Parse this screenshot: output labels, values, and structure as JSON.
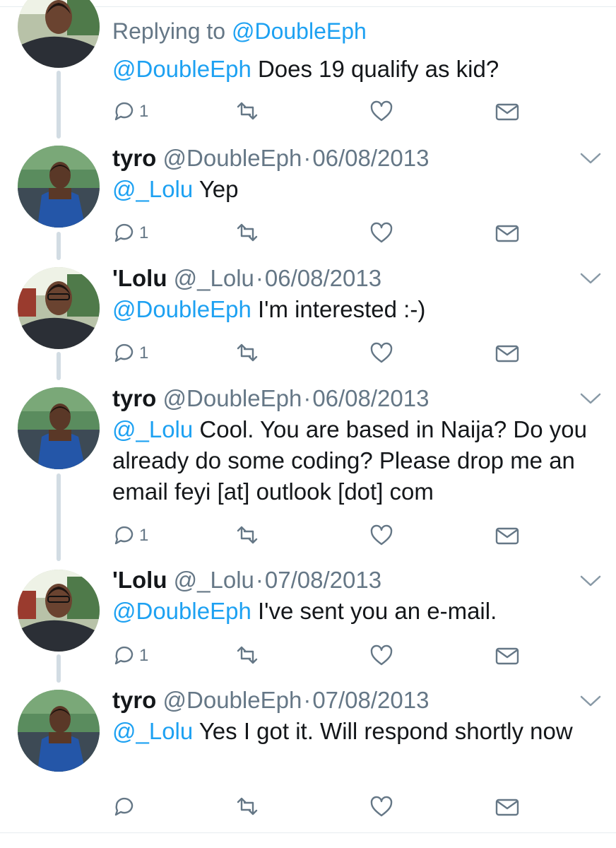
{
  "tweets": [
    {
      "avatar": "lolu-avatar",
      "replying_prefix": "Replying to",
      "replying_to": "@DoubleEph",
      "mention": "@DoubleEph",
      "text": "Does 19 qualify as kid?",
      "reply_count": "1"
    },
    {
      "avatar": "tyro-avatar",
      "name": "tyro",
      "handle": "@DoubleEph",
      "separator": "·",
      "date": "06/08/2013",
      "mention": "@_Lolu",
      "text": "Yep",
      "reply_count": "1"
    },
    {
      "avatar": "lolu-avatar",
      "name": "'Lolu",
      "handle": "@_Lolu",
      "separator": "·",
      "date": "06/08/2013",
      "mention": "@DoubleEph",
      "text": "I'm interested :-)",
      "reply_count": "1"
    },
    {
      "avatar": "tyro-avatar",
      "name": "tyro",
      "handle": "@DoubleEph",
      "separator": "·",
      "date": "06/08/2013",
      "mention": "@_Lolu",
      "text": "Cool. You are based in Naija? Do you already do some coding? Please drop me an email feyi [at] outlook [dot] com",
      "reply_count": "1"
    },
    {
      "avatar": "lolu-avatar",
      "name": "'Lolu",
      "handle": "@_Lolu",
      "separator": "·",
      "date": "07/08/2013",
      "mention": "@DoubleEph",
      "text": "I've sent you an e-mail.",
      "reply_count": "1"
    },
    {
      "avatar": "tyro-avatar",
      "name": "tyro",
      "handle": "@DoubleEph",
      "separator": "·",
      "date": "07/08/2013",
      "mention": "@_Lolu",
      "text": "Yes I got it. Will respond shortly now",
      "reply_count": ""
    }
  ],
  "icons": {
    "reply": "reply-icon",
    "retweet": "retweet-icon",
    "like": "heart-icon",
    "dm": "envelope-icon",
    "more": "chevron-down-icon"
  },
  "colors": {
    "link": "#1da1f2",
    "secondary": "#657786",
    "icon": "#657786",
    "thread_line": "#d2dce3"
  }
}
